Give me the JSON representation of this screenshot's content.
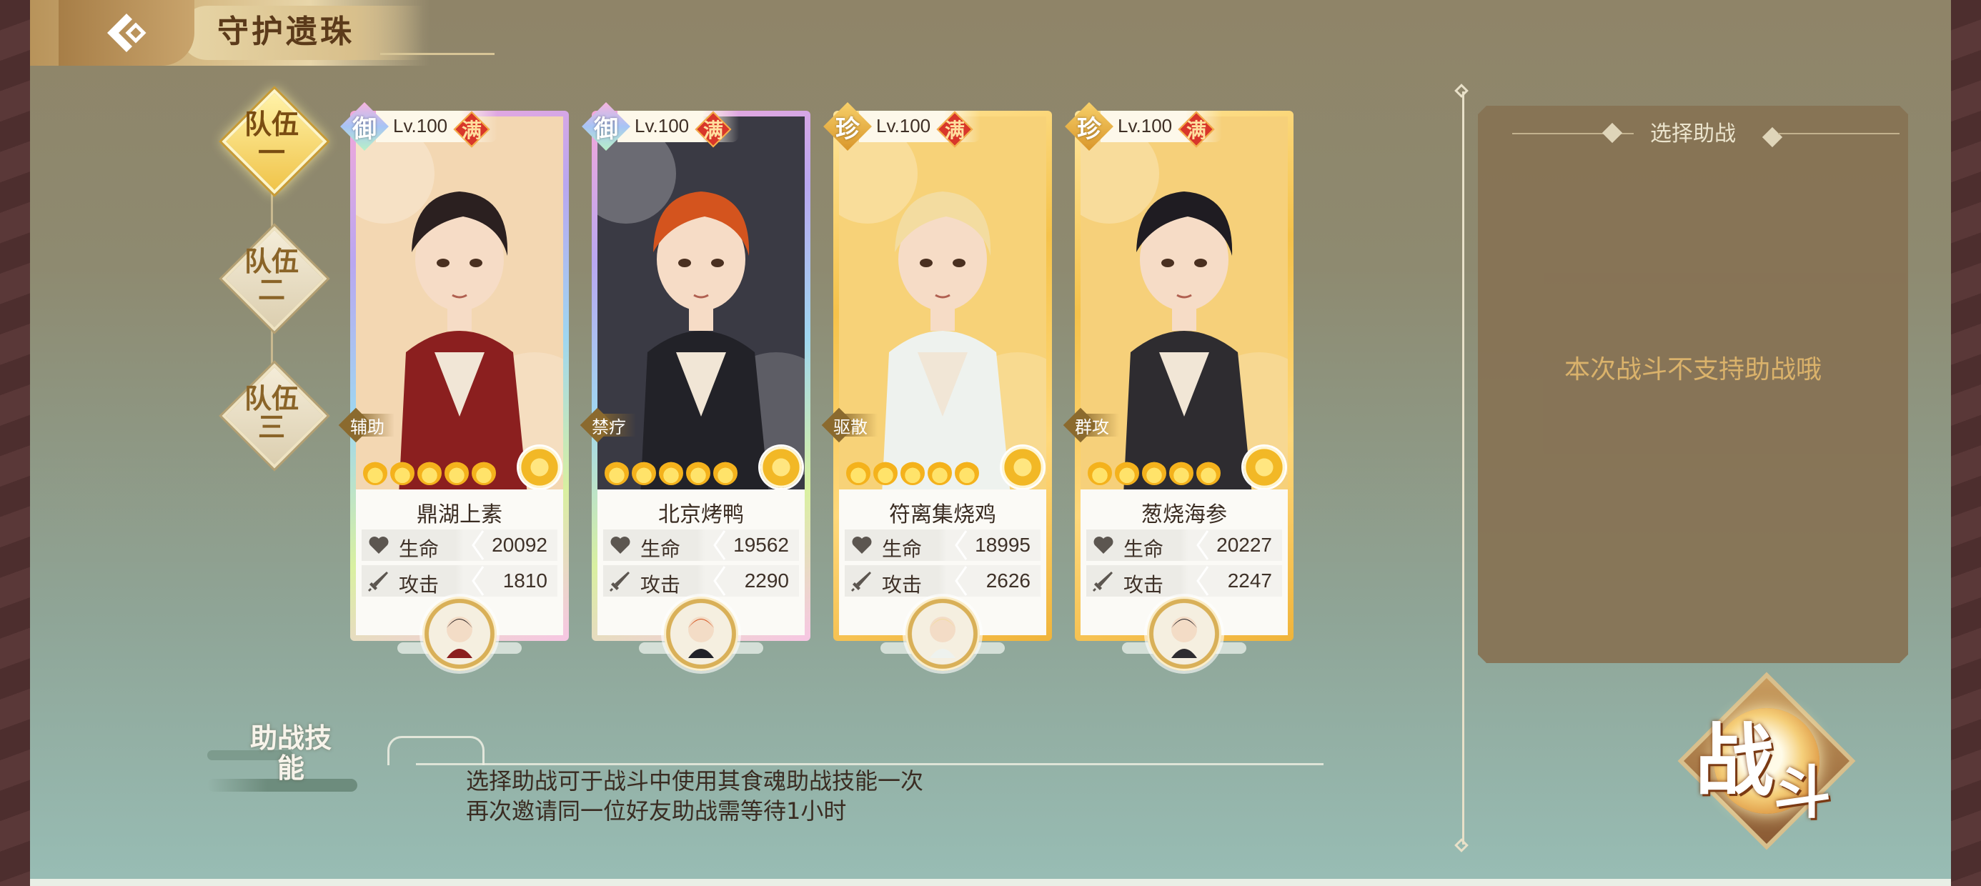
{
  "header": {
    "title": "守护遗珠"
  },
  "teams": [
    {
      "label": "队伍一",
      "active": true
    },
    {
      "label": "队伍二",
      "active": false
    },
    {
      "label": "队伍三",
      "active": false
    }
  ],
  "cards": [
    {
      "grade": "御",
      "level": "Lv.100",
      "max": "满",
      "role": "辅助",
      "name": "鼎湖上素",
      "hp_label": "生命",
      "hp": "20092",
      "atk_label": "攻击",
      "atk": "1810",
      "frame": "rainbow",
      "art_bg": "#f3d7b2",
      "hair": "#2b2020",
      "robe": "#8b1f1f"
    },
    {
      "grade": "御",
      "level": "Lv.100",
      "max": "满",
      "role": "禁疗",
      "name": "北京烤鸭",
      "hp_label": "生命",
      "hp": "19562",
      "atk_label": "攻击",
      "atk": "2290",
      "frame": "rainbow",
      "art_bg": "#3a3a44",
      "hair": "#d4541e",
      "robe": "#222228"
    },
    {
      "grade": "珍",
      "level": "Lv.100",
      "max": "满",
      "role": "驱散",
      "name": "符离集烧鸡",
      "hp_label": "生命",
      "hp": "18995",
      "atk_label": "攻击",
      "atk": "2626",
      "frame": "gold",
      "art_bg": "#f7d278",
      "hair": "#f3dca0",
      "robe": "#eef2ee"
    },
    {
      "grade": "珍",
      "level": "Lv.100",
      "max": "满",
      "role": "群攻",
      "name": "葱烧海参",
      "hp_label": "生命",
      "hp": "20227",
      "atk_label": "攻击",
      "atk": "2247",
      "frame": "gold",
      "art_bg": "#f6d07a",
      "hair": "#1f1c22",
      "robe": "#2e2c30"
    }
  ],
  "support": {
    "title": "选择助战",
    "message": "本次战斗不支持助战哦"
  },
  "help": {
    "label": "助战技能",
    "line1": "选择助战可于战斗中使用其食魂助战技能一次",
    "line2": "再次邀请同一位好友助战需等待1小时"
  },
  "fight": {
    "label_1": "战",
    "label_2": "斗"
  },
  "colors": {
    "accent_gold": "#f0c44a",
    "panel": "#877254",
    "support_msg": "#e1b56a"
  }
}
